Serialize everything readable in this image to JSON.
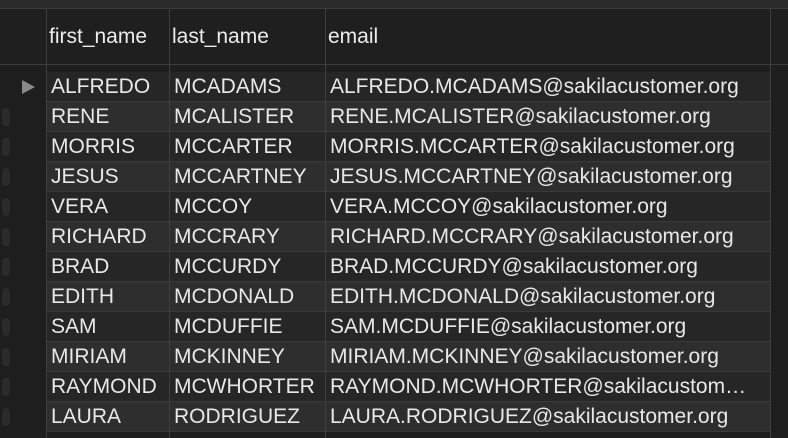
{
  "columns": {
    "first_name": "first_name",
    "last_name": "last_name",
    "email": "email"
  },
  "rows": [
    {
      "first_name": "ALFREDO",
      "last_name": "MCADAMS",
      "email": "ALFREDO.MCADAMS@sakilacustomer.org",
      "selected": true
    },
    {
      "first_name": "RENE",
      "last_name": "MCALISTER",
      "email": "RENE.MCALISTER@sakilacustomer.org"
    },
    {
      "first_name": "MORRIS",
      "last_name": "MCCARTER",
      "email": "MORRIS.MCCARTER@sakilacustomer.org"
    },
    {
      "first_name": "JESUS",
      "last_name": "MCCARTNEY",
      "email": "JESUS.MCCARTNEY@sakilacustomer.org"
    },
    {
      "first_name": "VERA",
      "last_name": "MCCOY",
      "email": "VERA.MCCOY@sakilacustomer.org"
    },
    {
      "first_name": "RICHARD",
      "last_name": "MCCRARY",
      "email": "RICHARD.MCCRARY@sakilacustomer.org"
    },
    {
      "first_name": "BRAD",
      "last_name": "MCCURDY",
      "email": "BRAD.MCCURDY@sakilacustomer.org"
    },
    {
      "first_name": "EDITH",
      "last_name": "MCDONALD",
      "email": "EDITH.MCDONALD@sakilacustomer.org"
    },
    {
      "first_name": "SAM",
      "last_name": "MCDUFFIE",
      "email": "SAM.MCDUFFIE@sakilacustomer.org"
    },
    {
      "first_name": "MIRIAM",
      "last_name": "MCKINNEY",
      "email": "MIRIAM.MCKINNEY@sakilacustomer.org"
    },
    {
      "first_name": "RAYMOND",
      "last_name": "MCWHORTER",
      "email": "RAYMOND.MCWHORTER@sakilacustom…"
    },
    {
      "first_name": "LAURA",
      "last_name": "RODRIGUEZ",
      "email": "LAURA.RODRIGUEZ@sakilacustomer.org"
    }
  ],
  "icons": {
    "current_row": "play-triangle-icon"
  },
  "colors": {
    "background": "#1e1e1e",
    "row_odd": "#262626",
    "row_even": "#2e2e2e",
    "text": "#e8e8e8"
  }
}
